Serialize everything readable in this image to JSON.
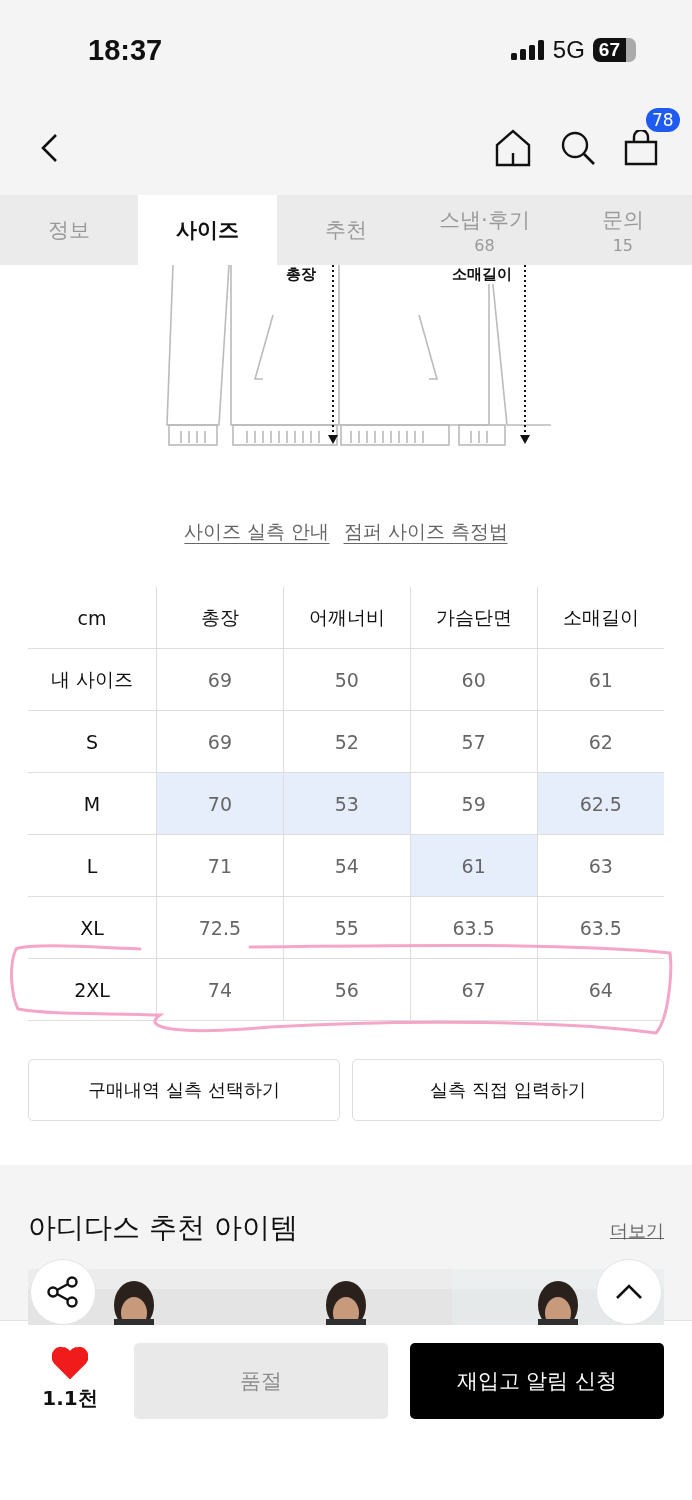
{
  "status_bar": {
    "time": "18:37",
    "network": "5G",
    "battery": "67"
  },
  "header": {
    "cart_count": "78"
  },
  "tabs": [
    {
      "label": "정보",
      "selected": false
    },
    {
      "label": "사이즈",
      "selected": true
    },
    {
      "label": "추천",
      "selected": false
    },
    {
      "label": "스냅·후기",
      "count": "68",
      "selected": false
    },
    {
      "label": "문의",
      "count": "15",
      "selected": false
    }
  ],
  "diagram": {
    "labels": [
      "총장",
      "소매길이"
    ]
  },
  "links": [
    "사이즈 실측 안내",
    "점퍼 사이즈 측정법"
  ],
  "size_table": {
    "corner": "cm",
    "columns": [
      "총장",
      "어깨너비",
      "가슴단면",
      "소매길이"
    ],
    "rows": [
      {
        "label": "내 사이즈",
        "circled": false,
        "cells": [
          {
            "value": "69",
            "highlighted": false
          },
          {
            "value": "50",
            "highlighted": false
          },
          {
            "value": "60",
            "highlighted": false
          },
          {
            "value": "61",
            "highlighted": false
          }
        ]
      },
      {
        "label": "S",
        "circled": false,
        "cells": [
          {
            "value": "69",
            "highlighted": false
          },
          {
            "value": "52",
            "highlighted": false
          },
          {
            "value": "57",
            "highlighted": false
          },
          {
            "value": "62",
            "highlighted": false
          }
        ]
      },
      {
        "label": "M",
        "circled": false,
        "cells": [
          {
            "value": "70",
            "highlighted": true
          },
          {
            "value": "53",
            "highlighted": true
          },
          {
            "value": "59",
            "highlighted": false
          },
          {
            "value": "62.5",
            "highlighted": true
          }
        ]
      },
      {
        "label": "L",
        "circled": false,
        "cells": [
          {
            "value": "71",
            "highlighted": false
          },
          {
            "value": "54",
            "highlighted": false
          },
          {
            "value": "61",
            "highlighted": true
          },
          {
            "value": "63",
            "highlighted": false
          }
        ]
      },
      {
        "label": "XL",
        "circled": false,
        "cells": [
          {
            "value": "72.5",
            "highlighted": false
          },
          {
            "value": "55",
            "highlighted": false
          },
          {
            "value": "63.5",
            "highlighted": false
          },
          {
            "value": "63.5",
            "highlighted": false
          }
        ]
      },
      {
        "label": "2XL",
        "circled": true,
        "cells": [
          {
            "value": "74",
            "highlighted": false
          },
          {
            "value": "56",
            "highlighted": false
          },
          {
            "value": "67",
            "highlighted": false
          },
          {
            "value": "64",
            "highlighted": false
          }
        ]
      }
    ]
  },
  "size_buttons": [
    "구매내역 실측 선택하기",
    "실측 직접 입력하기"
  ],
  "recommend": {
    "title": "아디다스 추천 아이템",
    "more": "더보기"
  },
  "bottom_bar": {
    "likes": "1.1천",
    "liked": true,
    "sold_out": "품절",
    "restock": "재입고 알림 신청"
  }
}
